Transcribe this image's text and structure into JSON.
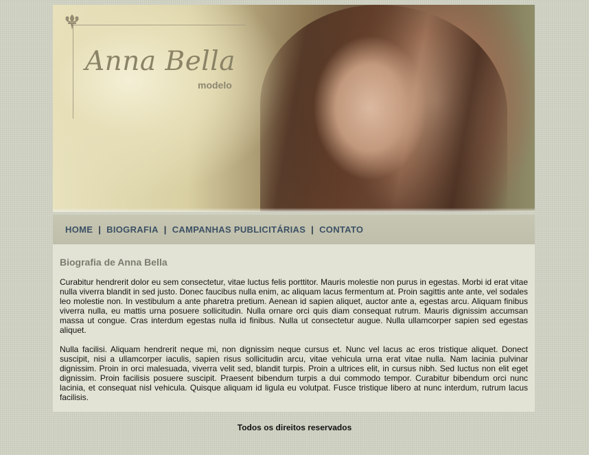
{
  "banner": {
    "logo_name": "Anna Bella",
    "logo_subtitle": "modelo",
    "logo_icon": "fleur-de-lis-icon"
  },
  "nav": {
    "items": [
      {
        "label": "HOME"
      },
      {
        "label": "BIOGRAFIA"
      },
      {
        "label": "CAMPANHAS PUBLICITÁRIAS"
      },
      {
        "label": "CONTATO"
      }
    ],
    "separator": "|"
  },
  "main": {
    "title": "Biografia de Anna Bella",
    "paragraphs": [
      "Curabitur hendrerit dolor eu sem consectetur, vitae luctus felis porttitor. Mauris molestie non purus in egestas. Morbi id erat vitae nulla viverra blandit in sed justo. Donec faucibus nulla enim, ac aliquam lacus fermentum at. Proin sagittis ante ante, vel sodales leo molestie non. In vestibulum a ante pharetra pretium. Aenean id sapien aliquet, auctor ante a, egestas arcu. Aliquam finibus viverra nulla, eu mattis urna posuere sollicitudin. Nulla ornare orci quis diam consequat rutrum. Mauris dignissim accumsan massa ut congue. Cras interdum egestas nulla id finibus. Nulla ut consectetur augue. Nulla ullamcorper sapien sed egestas aliquet.",
      "Nulla facilisi. Aliquam hendrerit neque mi, non dignissim neque cursus et. Nunc vel lacus ac eros tristique aliquet. Donect suscipit, nisi a ullamcorper iaculis, sapien risus sollicitudin arcu, vitae vehicula urna erat vitae nulla. Nam lacinia pulvinar dignissim. Proin in orci malesuada, viverra velit sed, blandit turpis. Proin a ultrices elit, in cursus nibh. Sed luctus non elit eget dignissim. Proin facilisis posuere suscipit. Praesent bibendum turpis a dui commodo tempor. Curabitur bibendum orci nunc lacinia, et consequat nisl vehicula. Quisque aliquam id ligula eu volutpat. Fusce tristique libero at nunc interdum, rutrum lacus facilisis."
    ]
  },
  "footer": {
    "text": "Todos os direitos reservados"
  },
  "colors": {
    "page_background": "#cfd1c2",
    "nav_background": "#c3c3af",
    "nav_link": "#3c5064",
    "content_background": "#e2e3d4",
    "title": "#7b7b70"
  }
}
